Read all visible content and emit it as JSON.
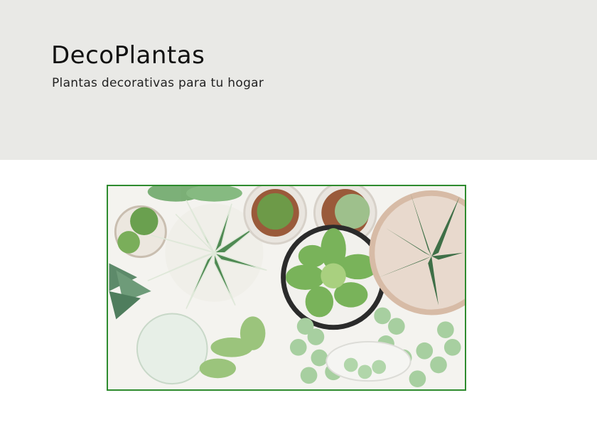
{
  "header": {
    "title": "DecoPlantas",
    "subtitle": "Plantas decorativas para tu hogar"
  },
  "hero_image": {
    "icon": "succulents-photo",
    "border_color": "#2e8b2e"
  },
  "colors": {
    "header_bg": "#e9e9e6",
    "page_bg": "#ffffff"
  }
}
